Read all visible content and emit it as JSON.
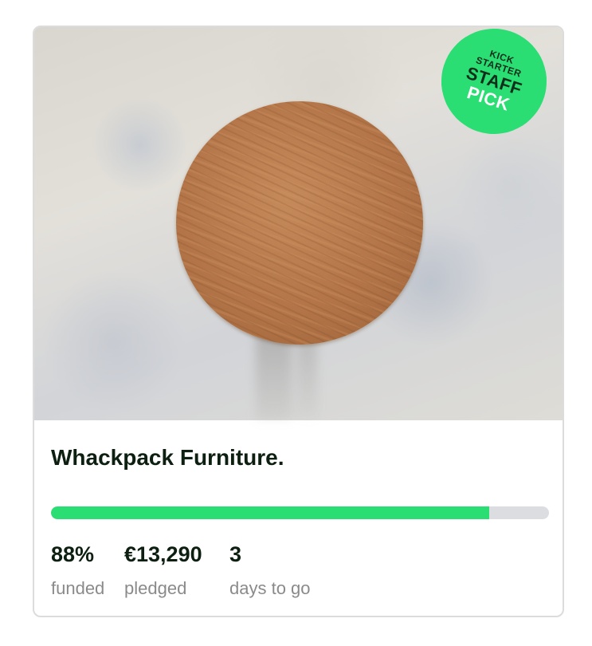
{
  "project": {
    "title": "Whackpack Furniture.",
    "funded_fraction": 0.88
  },
  "badge": {
    "line1": "KICK",
    "line2": "STARTER",
    "line3": "STAFF",
    "line4": "PICK",
    "color": "#2bde73"
  },
  "stats": [
    {
      "value": "88%",
      "label": "funded"
    },
    {
      "value": "€13,290",
      "label": "pledged"
    },
    {
      "value": "3",
      "label": "days to go"
    }
  ],
  "colors": {
    "accent": "#2bde73",
    "track": "#dcdde1",
    "text": "#0c1f10",
    "muted": "#8a8a8a"
  }
}
